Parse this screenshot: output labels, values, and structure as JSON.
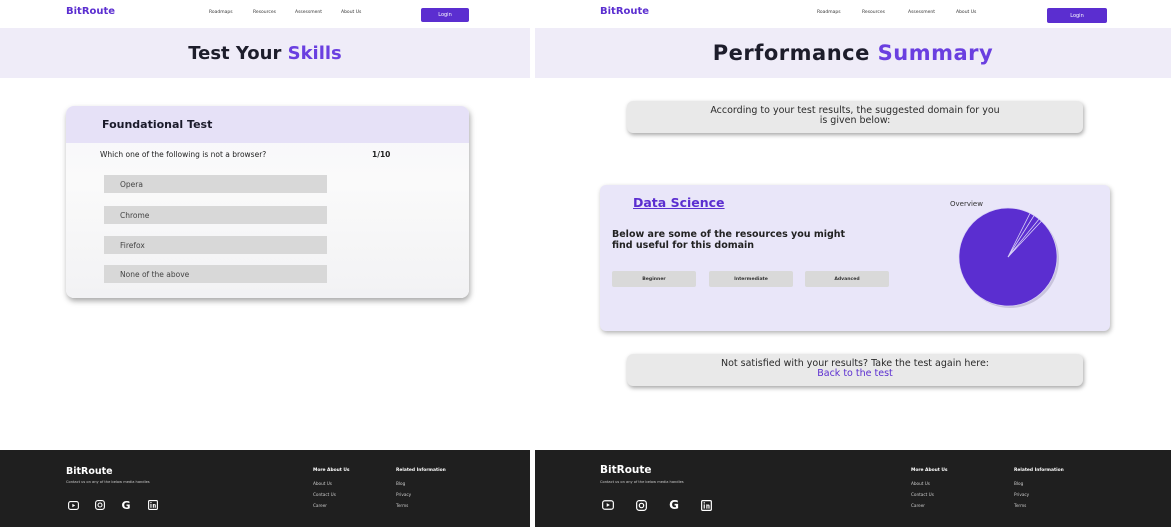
{
  "colors": {
    "accent": "#5b2ed0",
    "hero_bg": "#efecf8",
    "footer_bg": "#1f1f1f"
  },
  "left": {
    "nav": {
      "brand": "BitRoute",
      "links": [
        "Roadmaps",
        "Resources",
        "Assessment",
        "About Us"
      ],
      "login": "Login"
    },
    "hero": {
      "title_plain": "Test Your ",
      "title_accent": "Skills"
    },
    "test": {
      "title": "Foundational Test",
      "question": "Which one of the following is not a browser?",
      "counter": "1/10",
      "options": [
        "Opera",
        "Chrome",
        "Firefox",
        "None of the above"
      ]
    },
    "footer": {
      "brand": "BitRoute",
      "tagline": "Contact us on any of the below media handles",
      "icons": [
        "youtube-icon",
        "instagram-icon",
        "google-icon",
        "linkedin-icon"
      ],
      "col1_title": "More About Us",
      "col1_links": [
        "About Us",
        "Contact Us",
        "Career"
      ],
      "col2_title": "Related Information",
      "col2_links": [
        "Blog",
        "Privacy",
        "Terms"
      ]
    }
  },
  "right": {
    "nav": {
      "brand": "BitRoute",
      "links": [
        "Roadmaps",
        "Resources",
        "Assessment",
        "About Us"
      ],
      "login": "Login"
    },
    "hero": {
      "title_plain": "Performance ",
      "title_accent": "Summary"
    },
    "suggestion": {
      "line1": "According to your test results, the suggested domain for you",
      "line2": "is given below:"
    },
    "domain": {
      "title": "Data Science",
      "description": "Below are some of the resources you might find useful for this domain",
      "levels": [
        "Beginner",
        "Intermediate",
        "Advanced"
      ],
      "overview_label": "Overview"
    },
    "retake": {
      "text": "Not satisfied with your results? Take the test again here:",
      "link": "Back to the test"
    },
    "footer": {
      "brand": "BitRoute",
      "tagline": "Contact us on any of the below media handles",
      "icons": [
        "youtube-icon",
        "instagram-icon",
        "google-icon",
        "linkedin-icon"
      ],
      "col1_title": "More About Us",
      "col1_links": [
        "About Us",
        "Contact Us",
        "Career"
      ],
      "col2_title": "Related Information",
      "col2_links": [
        "Blog",
        "Privacy",
        "Terms"
      ]
    }
  },
  "chart_data": {
    "type": "pie",
    "title": "Overview",
    "values": [
      0.955,
      0.015,
      0.02,
      0.01
    ],
    "color": "#5b2ed0"
  }
}
